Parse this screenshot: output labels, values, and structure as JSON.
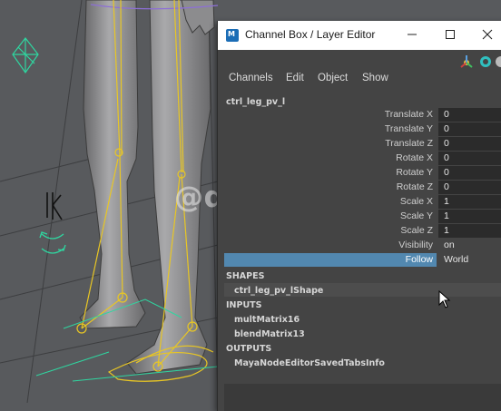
{
  "viewport": {
    "watermark": "@dawn_arc",
    "ik_label": "IK"
  },
  "window": {
    "title": "Channel Box / Layer Editor",
    "app_icon_text": "M",
    "menus": [
      "Channels",
      "Edit",
      "Object",
      "Show"
    ],
    "node_name": "ctrl_leg_pv_l",
    "attributes": [
      {
        "label": "Translate X",
        "value": "0"
      },
      {
        "label": "Translate Y",
        "value": "0"
      },
      {
        "label": "Translate Z",
        "value": "0"
      },
      {
        "label": "Rotate X",
        "value": "0"
      },
      {
        "label": "Rotate Y",
        "value": "0"
      },
      {
        "label": "Rotate Z",
        "value": "0"
      },
      {
        "label": "Scale X",
        "value": "1"
      },
      {
        "label": "Scale Y",
        "value": "1"
      },
      {
        "label": "Scale Z",
        "value": "1"
      },
      {
        "label": "Visibility",
        "value": "on"
      },
      {
        "label": "Follow",
        "value": "World",
        "selected": true
      }
    ],
    "shapes": {
      "header": "SHAPES",
      "items": [
        "ctrl_leg_pv_lShape"
      ]
    },
    "inputs": {
      "header": "INPUTS",
      "items": [
        "multMatrix16",
        "blendMatrix13"
      ]
    },
    "outputs": {
      "header": "OUTPUTS",
      "items": [
        "MayaNodeEditorSavedTabsInfo"
      ]
    }
  },
  "colors": {
    "selection": "#5288b0",
    "rig_yellow": "#e8c624",
    "control_green": "#2fd6a0",
    "viewport_bg": "#585a5d"
  }
}
